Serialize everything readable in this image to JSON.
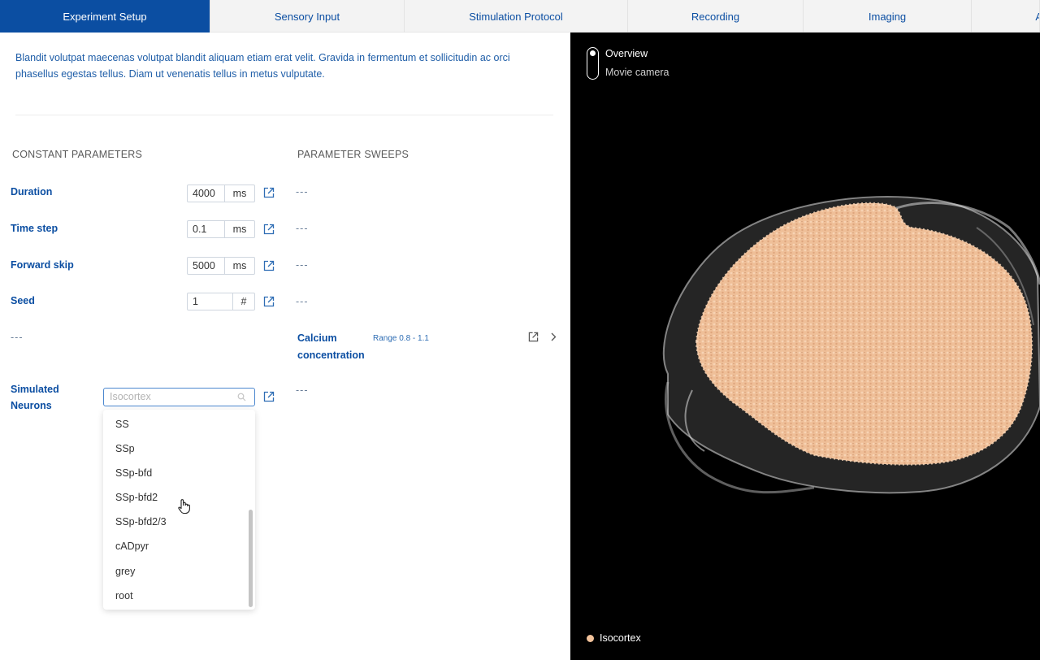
{
  "tabs": [
    {
      "label": "Experiment Setup",
      "active": true
    },
    {
      "label": "Sensory Input"
    },
    {
      "label": "Stimulation Protocol"
    },
    {
      "label": "Recording"
    },
    {
      "label": "Imaging"
    },
    {
      "label": "A"
    }
  ],
  "intro": "Blandit volutpat maecenas volutpat blandit aliquam etiam erat velit. Gravida in fermentum et sollicitudin ac orci phasellus egestas tellus. Diam ut venenatis tellus in metus vulputate.",
  "sections": {
    "constant": "CONSTANT PARAMETERS",
    "sweeps": "PARAMETER SWEEPS"
  },
  "params": {
    "duration": {
      "label": "Duration",
      "value": "4000",
      "unit": "ms",
      "sweep": "---"
    },
    "time_step": {
      "label": "Time step",
      "value": "0.1",
      "unit": "ms",
      "sweep": "---"
    },
    "forward_skip": {
      "label": "Forward skip",
      "value": "5000",
      "unit": "ms",
      "sweep": "---"
    },
    "seed": {
      "label": "Seed",
      "value": "1",
      "unit": "#",
      "sweep": "---"
    }
  },
  "empty_constant": "---",
  "calcium": {
    "label_line1": "Calcium",
    "label_line2": "concentration",
    "range": "Range 0.8 - 1.1"
  },
  "simulated_neurons": {
    "label_line1": "Simulated",
    "label_line2": "Neurons",
    "placeholder": "Isocortex",
    "sweep": "---",
    "options": [
      "SS",
      "SSp",
      "SSp-bfd",
      "SSp-bfd2",
      "SSp-bfd2/3",
      "cADpyr",
      "grey",
      "root"
    ]
  },
  "viewer": {
    "option_overview": "Overview",
    "option_movie": "Movie camera",
    "legend_label": "Isocortex",
    "legend_color": "#f2c29b"
  },
  "colors": {
    "accent": "#0b4ea2"
  }
}
